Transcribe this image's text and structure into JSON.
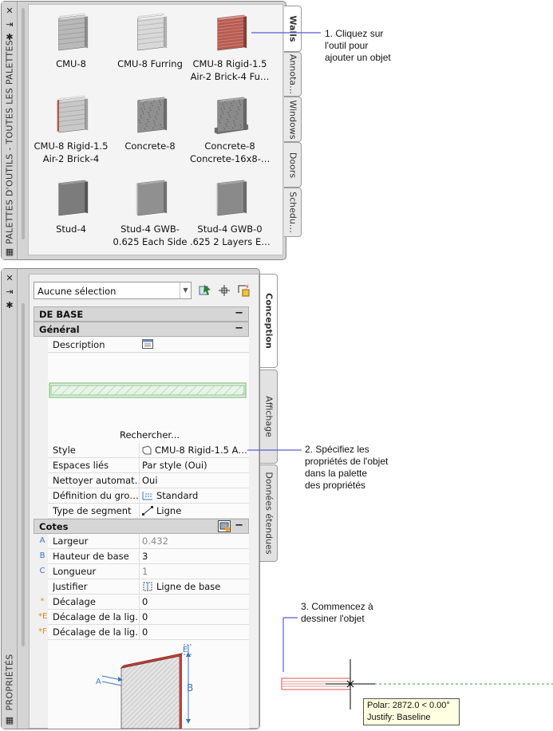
{
  "tool_palette": {
    "title": "PALETTES D'OUTILS - TOUTES LES PALETTES",
    "tools": [
      {
        "label_1": "CMU-8",
        "label_2": "",
        "thumb": "cmu"
      },
      {
        "label_1": "CMU-8 Furring",
        "label_2": "",
        "thumb": "furring"
      },
      {
        "label_1": "CMU-8 Rigid-1.5",
        "label_2": "Air-2 Brick-4 Fu…",
        "thumb": "brick"
      },
      {
        "label_1": "CMU-8 Rigid-1.5",
        "label_2": "Air-2 Brick-4",
        "thumb": "cmu-brick"
      },
      {
        "label_1": "Concrete-8",
        "label_2": "",
        "thumb": "concrete"
      },
      {
        "label_1": "Concrete-8",
        "label_2": "Concrete-16x8-…",
        "thumb": "concrete-footing"
      },
      {
        "label_1": "Stud-4",
        "label_2": "",
        "thumb": "stud"
      },
      {
        "label_1": "Stud-4 GWB-",
        "label_2": "0.625 Each Side",
        "thumb": "stud-gwb"
      },
      {
        "label_1": "Stud-4 GWB-0",
        "label_2": ".625 2 Layers E…",
        "thumb": "stud-gwb2"
      }
    ],
    "tabs": [
      "Walls",
      "Annota…",
      "Windows",
      "Doors",
      "Schedu…"
    ]
  },
  "properties": {
    "title": "PROPRIÉTÉS",
    "selection": "Aucune sélection",
    "tabs": [
      "Conception",
      "Affichage",
      "Données étendues"
    ],
    "sections": {
      "base": "DE BASE",
      "general": "Général",
      "cotes": "Cotes"
    },
    "collapse": "−",
    "description_label": "Description",
    "rechercher": "Rechercher...",
    "general_rows": [
      {
        "key": "Style",
        "value": "CMU-8 Rigid-1.5 A…",
        "icon": "style-icon"
      },
      {
        "key": "Espaces liés",
        "value": "Par style (Oui)"
      },
      {
        "key": "Nettoyer automat…",
        "value": "Oui"
      },
      {
        "key": "Définition du gro…",
        "value": "Standard",
        "icon": "grid-definition-icon"
      },
      {
        "key": "Type de segment",
        "value": "Ligne",
        "icon": "line-segment-icon"
      }
    ],
    "cotes_rows": [
      {
        "letter": "A",
        "key": "Largeur",
        "value": "0.432",
        "grey": true
      },
      {
        "letter": "B",
        "key": "Hauteur de base",
        "value": "3"
      },
      {
        "letter": "C",
        "key": "Longueur",
        "value": "1",
        "grey": true
      },
      {
        "letter": "",
        "key": "Justifier",
        "value": "Ligne de base",
        "icon": "justify-icon"
      },
      {
        "letter": "*",
        "key": "Décalage",
        "value": "0"
      },
      {
        "letter": "*E",
        "key": "Décalage de la lig…",
        "value": "0"
      },
      {
        "letter": "*F",
        "key": "Décalage de la lig…",
        "value": "0"
      }
    ],
    "diagram_labels": {
      "a": "A",
      "b": "B",
      "e": "E"
    }
  },
  "annotations": {
    "step1": [
      "1. Cliquez sur",
      "l'outil pour",
      "ajouter un objet"
    ],
    "step2": [
      "2. Spécifiez les",
      "propriétés de l'objet",
      "dans la palette",
      "des propriétés"
    ],
    "step3": [
      "3. Commencez à",
      "dessiner l'objet"
    ]
  },
  "tooltip": {
    "polar": "Polar: 2872.0 < 0.00°",
    "justify": "Justify: Baseline"
  },
  "colors": {
    "leader_line": "#5b5bd6",
    "wall_red": "#c0584f",
    "tracking_green": "#3aa13a",
    "tooltip_bg": "#ffffe1"
  }
}
